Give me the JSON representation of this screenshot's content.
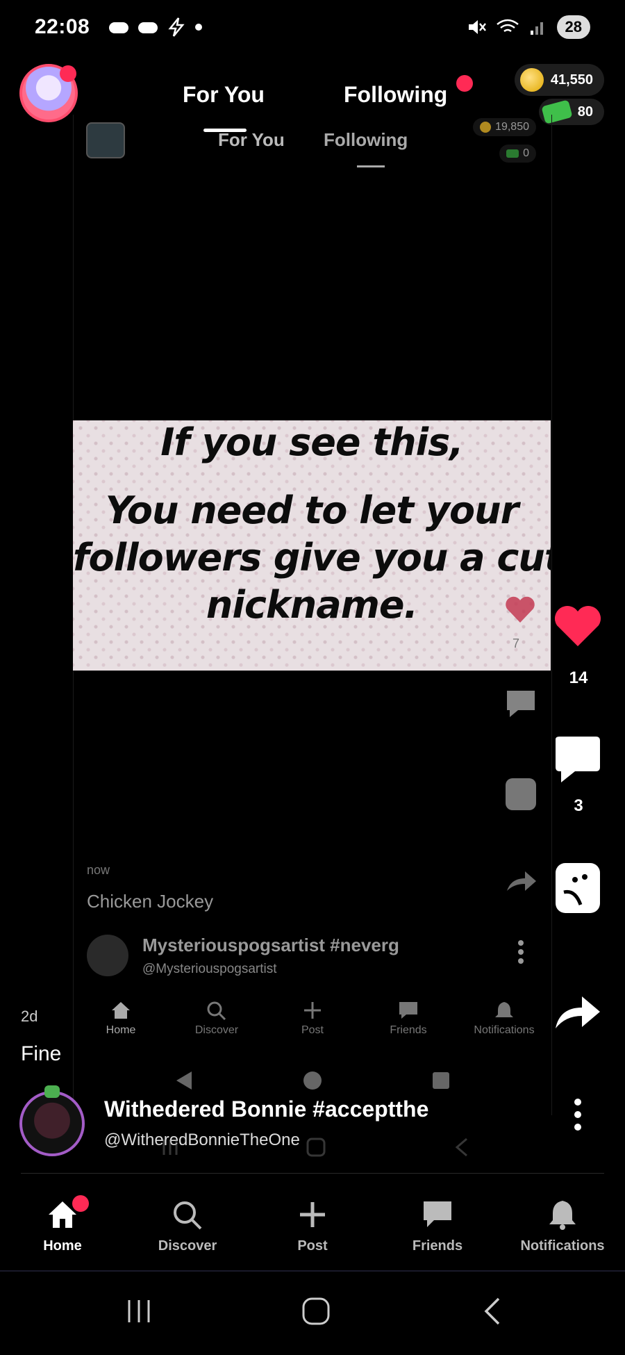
{
  "status_bar": {
    "time": "22:08",
    "battery": "28"
  },
  "header": {
    "tabs": [
      {
        "label": "For You"
      },
      {
        "label": "Following"
      }
    ],
    "coins": "41,550",
    "gems": "80"
  },
  "ghost": {
    "tabs": [
      {
        "label": "For You"
      },
      {
        "label": "Following"
      }
    ],
    "coins": "19,850",
    "gems": "0",
    "like_count": "7",
    "time": "now",
    "caption": "Chicken Jockey",
    "author_name": "Mysteriouspogsartist #neverg",
    "author_handle": "@Mysteriouspogsartist",
    "nav": [
      "Home",
      "Discover",
      "Post",
      "Friends",
      "Notifications"
    ]
  },
  "post": {
    "image_lines": [
      "If you see this,",
      "You need to let your",
      "followers give you a cute",
      "nickname."
    ],
    "like_count": "14",
    "comment_count": "3",
    "time": "2d",
    "caption": "Fine",
    "author_name": "Withedered Bonnie #acceptthe",
    "author_handle": "@WitheredBonnieTheOne"
  },
  "bottom_nav": [
    {
      "label": "Home",
      "icon": "home-icon",
      "active": true
    },
    {
      "label": "Discover",
      "icon": "search-icon"
    },
    {
      "label": "Post",
      "icon": "plus-icon"
    },
    {
      "label": "Friends",
      "icon": "chat-icon"
    },
    {
      "label": "Notifications",
      "icon": "bell-icon"
    }
  ],
  "colors": {
    "accent": "#ff2a55",
    "background": "#000000"
  }
}
